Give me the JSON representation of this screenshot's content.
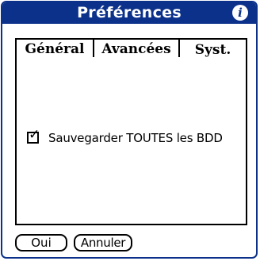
{
  "dialog": {
    "title": "Préférences",
    "info_icon": "info-icon"
  },
  "tabs": [
    {
      "label": "Général",
      "active": false
    },
    {
      "label": "Avancées",
      "active": false
    },
    {
      "label": "Syst.",
      "active": true
    }
  ],
  "system_panel": {
    "backup_all_checkbox": {
      "label": "Sauvegarder TOUTES les BDD",
      "checked": true
    }
  },
  "buttons": {
    "ok_label": "Oui",
    "cancel_label": "Annuler"
  },
  "colors": {
    "titlebar": "#0b318a",
    "background": "#ffffff",
    "border": "#000000"
  }
}
